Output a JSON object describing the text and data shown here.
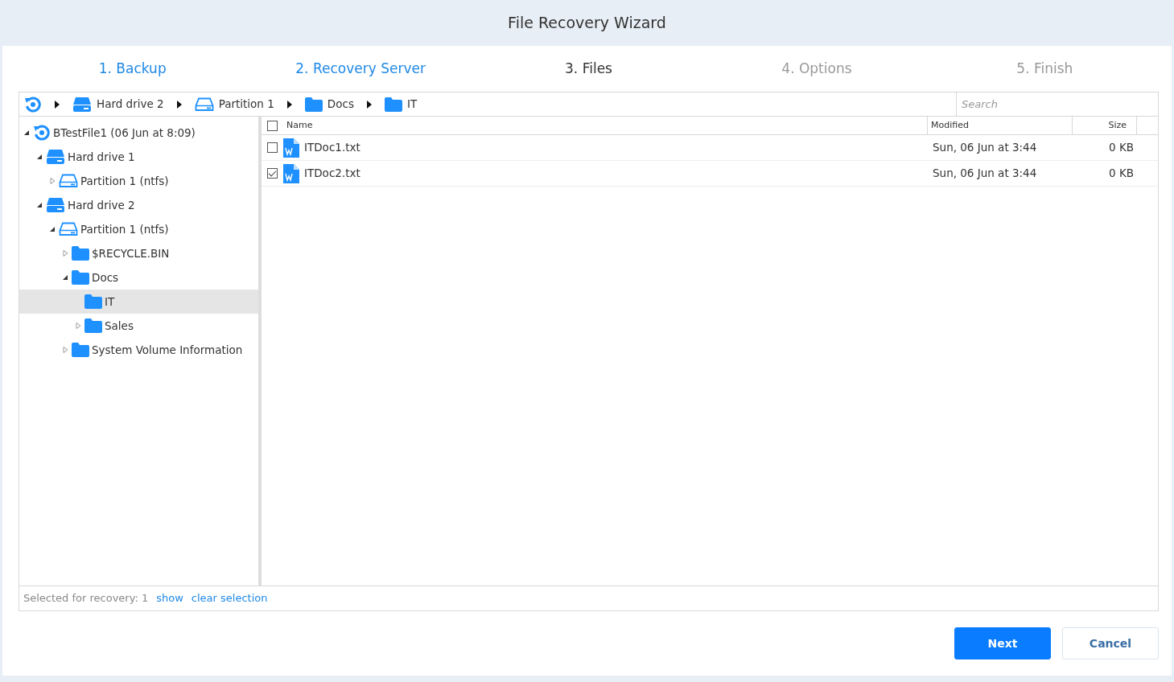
{
  "window": {
    "title": "File Recovery Wizard"
  },
  "steps": [
    {
      "label": "1. Backup",
      "completed": true,
      "selected": false
    },
    {
      "label": "2. Recovery Server",
      "completed": true,
      "selected": false
    },
    {
      "label": "3. Files",
      "completed": false,
      "selected": true
    },
    {
      "label": "4. Options",
      "completed": false,
      "selected": false
    },
    {
      "label": "5. Finish",
      "completed": false,
      "selected": false
    }
  ],
  "breadcrumb": [
    {
      "kind": "backup"
    },
    {
      "kind": "drive",
      "label": "Hard drive 2"
    },
    {
      "kind": "partition",
      "label": "Partition 1"
    },
    {
      "kind": "folder",
      "label": "Docs"
    },
    {
      "kind": "folder",
      "label": "IT"
    }
  ],
  "search": {
    "placeholder": "Search"
  },
  "tree": [
    {
      "kind": "backup",
      "label": "BTestFile1 (06 Jun at 8:09)",
      "expanded": true,
      "selected": false,
      "children": [
        {
          "kind": "drive",
          "label": "Hard drive 1",
          "expanded": true,
          "selected": false,
          "children": [
            {
              "kind": "partition",
              "label": "Partition 1 (ntfs)",
              "expanded": false,
              "selected": false
            }
          ]
        },
        {
          "kind": "drive",
          "label": "Hard drive 2",
          "expanded": true,
          "selected": false,
          "children": [
            {
              "kind": "partition",
              "label": "Partition 1 (ntfs)",
              "expanded": true,
              "selected": false,
              "children": [
                {
                  "kind": "folder",
                  "label": "$RECYCLE.BIN",
                  "expanded": false,
                  "selected": false
                },
                {
                  "kind": "folder",
                  "label": "Docs",
                  "expanded": true,
                  "selected": false,
                  "children": [
                    {
                      "kind": "folder",
                      "label": "IT",
                      "selected": true
                    },
                    {
                      "kind": "folder",
                      "label": "Sales",
                      "expanded": false,
                      "selected": false
                    }
                  ]
                },
                {
                  "kind": "folder",
                  "label": "System Volume Information",
                  "expanded": false,
                  "selected": false
                }
              ]
            }
          ]
        }
      ]
    }
  ],
  "table": {
    "columns": [
      "Name",
      "Modified",
      "Size"
    ],
    "all_checked": false,
    "rows": [
      {
        "name": "ITDoc1.txt",
        "modified": "Sun, 06 Jun at 3:44",
        "size": "0 KB",
        "checked": false
      },
      {
        "name": "ITDoc2.txt",
        "modified": "Sun, 06 Jun at 3:44",
        "size": "0 KB",
        "checked": true
      }
    ]
  },
  "status_bar": {
    "text": "Selected for recovery: 1",
    "links": [
      "show",
      "clear selection"
    ]
  },
  "buttons": [
    {
      "label": "Next",
      "kind": "primary"
    },
    {
      "label": "Cancel",
      "kind": "secondary"
    }
  ]
}
